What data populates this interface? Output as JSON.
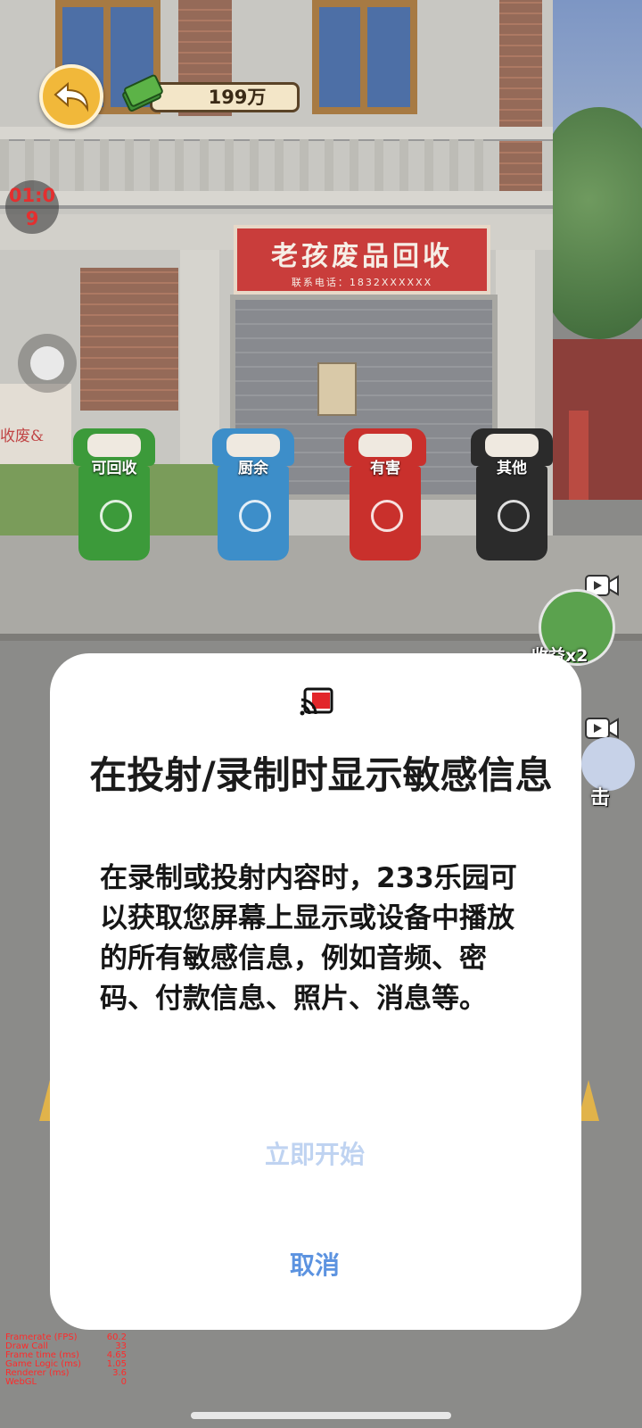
{
  "hud": {
    "money": "199万",
    "timer_line1": "01:0",
    "timer_line2": "9"
  },
  "scene": {
    "shop_sign_title": "老孩废品回收",
    "shop_sign_phone": "联系电话：1832XXXXXX",
    "wall_text": "收废&"
  },
  "bins": [
    {
      "label": "可回收",
      "color": "#3c9a3a"
    },
    {
      "label": "厨余",
      "color": "#3d8ec9"
    },
    {
      "label": "有害",
      "color": "#c9302c"
    },
    {
      "label": "其他",
      "color": "#2b2b2b"
    }
  ],
  "side": {
    "reward_label": "收益x2",
    "hit_label": "击"
  },
  "dialog": {
    "title": "在投射/录制时显示敏感信息",
    "message_prefix": "在录制或投射内容时，",
    "app_name": "233乐园",
    "message_suffix": "可以获取您屏幕上显示或设备中播放的所有敏感信息，例如音频、密码、付款信息、照片、消息等。",
    "start_button": "立即开始",
    "cancel_button": "取消"
  },
  "stats": [
    {
      "label": "Framerate (FPS)",
      "value": "60.2"
    },
    {
      "label": "Draw Call",
      "value": "33"
    },
    {
      "label": "Frame time (ms)",
      "value": "4.65"
    },
    {
      "label": "Game Logic (ms)",
      "value": "1.05"
    },
    {
      "label": "Renderer (ms)",
      "value": "3.6"
    },
    {
      "label": "WebGL",
      "value": "0"
    }
  ]
}
